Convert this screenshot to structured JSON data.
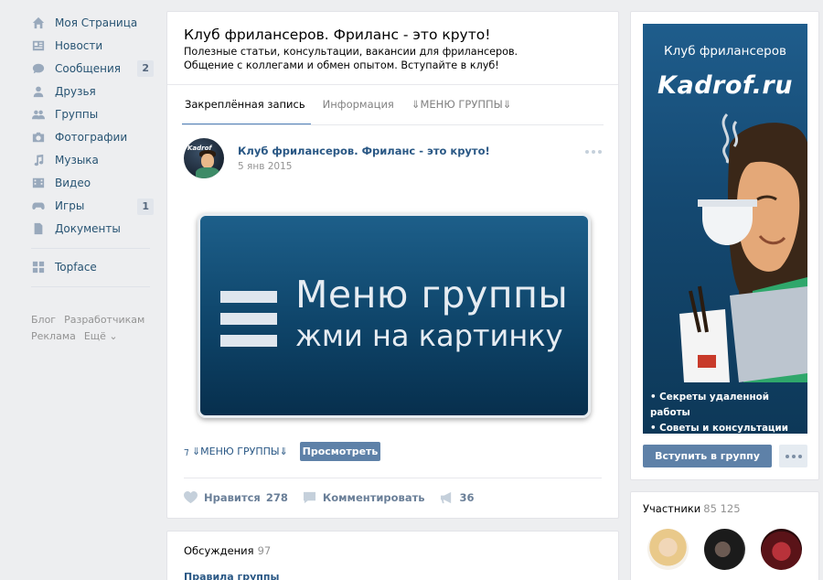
{
  "sidebar": {
    "items": [
      {
        "label": "Моя Страница",
        "icon": "home-icon"
      },
      {
        "label": "Новости",
        "icon": "news-icon"
      },
      {
        "label": "Сообщения",
        "icon": "messages-icon",
        "count": "2"
      },
      {
        "label": "Друзья",
        "icon": "friends-icon"
      },
      {
        "label": "Группы",
        "icon": "groups-icon"
      },
      {
        "label": "Фотографии",
        "icon": "camera-icon"
      },
      {
        "label": "Музыка",
        "icon": "music-icon"
      },
      {
        "label": "Видео",
        "icon": "video-icon"
      },
      {
        "label": "Игры",
        "icon": "games-icon",
        "count": "1"
      },
      {
        "label": "Документы",
        "icon": "document-icon"
      }
    ],
    "apps": [
      {
        "label": "Topface",
        "icon": "app-grid-icon"
      }
    ],
    "footer": [
      "Блог",
      "Разработчикам",
      "Реклама",
      "Ещё ⌄"
    ]
  },
  "group": {
    "title": "Клуб фрилансеров. Фриланс - это круто!",
    "description": "Полезные статьи, консультации, вакансии для фрилансеров. Общение с коллегами и обмен опытом. Вступайте в клуб!",
    "tabs": [
      "Закреплённая запись",
      "Информация",
      "⇓МЕНЮ ГРУППЫ⇓"
    ]
  },
  "post": {
    "avatar_text": "Kadrof",
    "author": "Клуб фрилансеров. Фриланс - это круто!",
    "date": "5 янв 2015",
    "banner_line1": "Меню группы",
    "banner_line2": "жми на картинку",
    "link_text": "⇓МЕНЮ ГРУППЫ⇓",
    "view_button": "Просмотреть",
    "like_label": "Нравится",
    "like_count": "278",
    "comment_label": "Комментировать",
    "share_count": "36"
  },
  "discussions": {
    "title": "Обсуждения",
    "count": "97",
    "first_topic": "Правила группы"
  },
  "cover": {
    "club_label": "Клуб фрилансеров",
    "logo": "Kadrof.ru",
    "bullets": [
      "Секреты удаленной работы",
      "Советы и консультации"
    ]
  },
  "join_button": "Вступить в группу",
  "members": {
    "title": "Участники",
    "count": "85 125"
  },
  "colors": {
    "accent": "#5181b8",
    "link": "#2a5885",
    "button": "#5e81a8",
    "banner": "#0e4469"
  }
}
